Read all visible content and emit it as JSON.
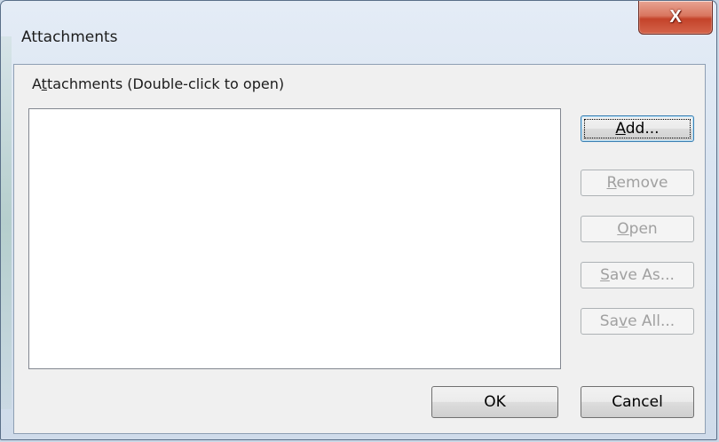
{
  "window": {
    "title": "Attachments",
    "close_glyph": "X"
  },
  "group": {
    "label_pre": "A",
    "label_accel": "t",
    "label_post": "tachments (Double-click to open)"
  },
  "buttons": {
    "add": {
      "pre": "",
      "accel": "A",
      "post": "dd..."
    },
    "remove": {
      "pre": "",
      "accel": "R",
      "post": "emove"
    },
    "open": {
      "pre": "",
      "accel": "O",
      "post": "pen"
    },
    "save_as": {
      "pre": "",
      "accel": "S",
      "post": "ave As..."
    },
    "save_all": {
      "pre": "Sa",
      "accel": "v",
      "post": "e All..."
    },
    "ok": "OK",
    "cancel": "Cancel"
  },
  "attachments": [],
  "colors": {
    "close_red": "#c4432a",
    "frame": "#d4e0ee",
    "client": "#f0f0f0",
    "default_border": "#3c7fb1",
    "disabled_text": "#a0a0a0"
  },
  "icons": {
    "close": "x-glyph"
  }
}
